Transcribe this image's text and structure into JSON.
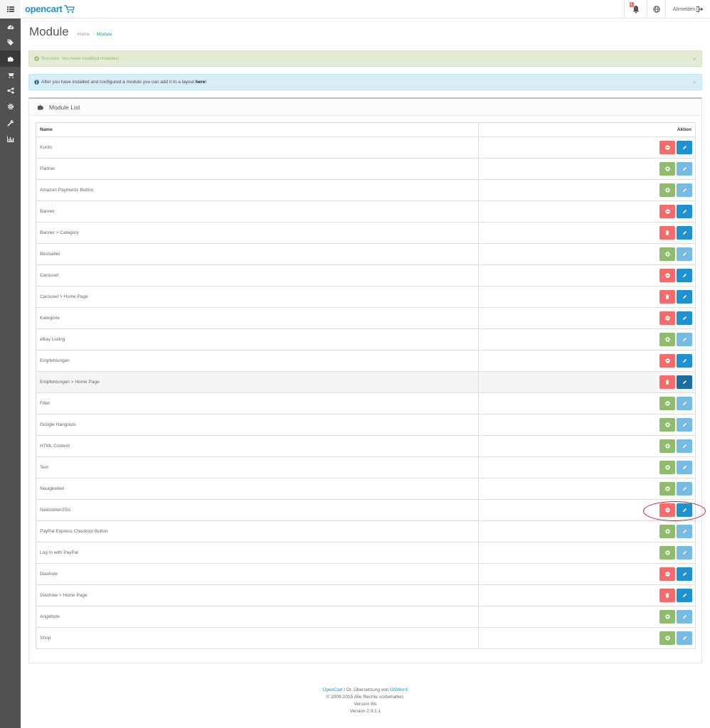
{
  "header": {
    "logo_text": "opencart",
    "notification_count": "1",
    "logout_label": "Abmelden"
  },
  "sidebar": {
    "items": [
      {
        "icon": "dashboard-icon"
      },
      {
        "icon": "tags-icon"
      },
      {
        "icon": "puzzle-icon",
        "active": true
      },
      {
        "icon": "cart-icon"
      },
      {
        "icon": "share-icon"
      },
      {
        "icon": "gear-icon"
      },
      {
        "icon": "wrench-icon"
      },
      {
        "icon": "bar-chart-icon"
      }
    ]
  },
  "page": {
    "title": "Module",
    "breadcrumb": [
      "Home",
      "Module"
    ]
  },
  "alerts": {
    "success": "Success: You have modified modules!",
    "info_prefix": "After you have installed and configured a module you can add it to a layout ",
    "info_link": "here",
    "info_suffix": "!",
    "close": "×"
  },
  "panel": {
    "title": "Module List"
  },
  "table": {
    "col_name": "Name",
    "col_action": "Aktion",
    "rows": [
      {
        "name": "Konto",
        "state": "installed",
        "edit": "enabled"
      },
      {
        "name": "Partner",
        "state": "not_installed",
        "edit": "disabled"
      },
      {
        "name": "Amazon Payments Button",
        "state": "not_installed",
        "edit": "disabled"
      },
      {
        "name": "Banner",
        "state": "installed",
        "edit": "enabled"
      },
      {
        "name": "Banner > Category",
        "state": "instance",
        "edit": "enabled"
      },
      {
        "name": "Bestseller",
        "state": "not_installed",
        "edit": "disabled"
      },
      {
        "name": "Carousel",
        "state": "installed",
        "edit": "enabled"
      },
      {
        "name": "Carousel > Home Page",
        "state": "instance",
        "edit": "enabled"
      },
      {
        "name": "Kategorie",
        "state": "installed",
        "edit": "enabled"
      },
      {
        "name": "eBay Listing",
        "state": "not_installed",
        "edit": "disabled"
      },
      {
        "name": "Empfehlungen",
        "state": "installed",
        "edit": "enabled"
      },
      {
        "name": "Empfehlungen > Home Page",
        "state": "instance",
        "edit": "dark",
        "hover": true
      },
      {
        "name": "Filter",
        "state": "not_installed",
        "edit": "disabled"
      },
      {
        "name": "Google Hangouts",
        "state": "not_installed",
        "edit": "disabled"
      },
      {
        "name": "HTML Content",
        "state": "not_installed",
        "edit": "disabled"
      },
      {
        "name": "Text",
        "state": "not_installed",
        "edit": "disabled"
      },
      {
        "name": "Neuigkeiten",
        "state": "not_installed",
        "edit": "disabled"
      },
      {
        "name": "Newsletter2Go",
        "state": "installed",
        "edit": "enabled"
      },
      {
        "name": "PayPal Express Checkout Button",
        "state": "not_installed",
        "edit": "disabled"
      },
      {
        "name": "Log In with PayPal",
        "state": "not_installed",
        "edit": "disabled"
      },
      {
        "name": "Diashow",
        "state": "installed",
        "edit": "enabled"
      },
      {
        "name": "Diashow > Home Page",
        "state": "instance",
        "edit": "enabled"
      },
      {
        "name": "Angebote",
        "state": "not_installed",
        "edit": "disabled"
      },
      {
        "name": "Shop",
        "state": "not_installed",
        "edit": "disabled"
      }
    ]
  },
  "footer": {
    "link1": "OpenCart",
    "middle": " / Dt. Übersetzung von ",
    "link2": "OSWorX",
    "copyright": "© 2009-2015 Alle Rechte vorbehalten.",
    "version1": "Version 9ts",
    "version2": "Version 2.0.1.1"
  },
  "colors": {
    "primary": "#1e91cf",
    "danger": "#f56b6b",
    "success": "#8fbb6c",
    "sidebar": "#515151",
    "highlight": "#c91a1a"
  }
}
